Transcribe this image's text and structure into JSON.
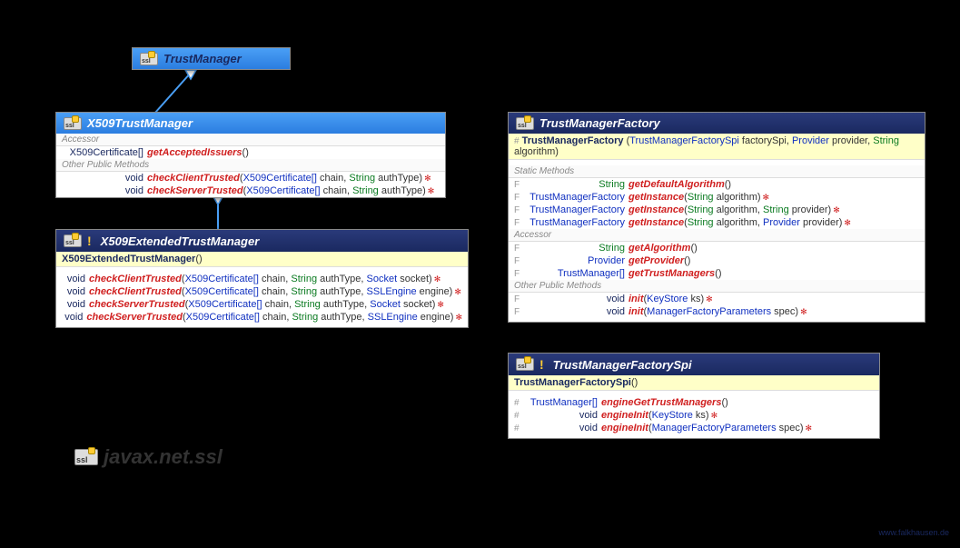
{
  "package": "javax.net.ssl",
  "sslBadge": "ssl",
  "footer": "www.falkhausen.de",
  "trustManager": {
    "title": "TrustManager"
  },
  "x509TrustManager": {
    "title": "X509TrustManager",
    "sec_accessor": "Accessor",
    "sec_other": "Other Public Methods",
    "m1_ret": "X509Certificate[]",
    "m1_name": "getAcceptedIssuers",
    "m1_params": "()",
    "m2_ret": "void",
    "m2_name": "checkClientTrusted",
    "m2_p1": "X509Certificate[]",
    "m2_p1n": " chain, ",
    "m2_p2": "String",
    "m2_p2n": " authType)",
    "m3_ret": "void",
    "m3_name": "checkServerTrusted",
    "m3_p1": "X509Certificate[]",
    "m3_p1n": " chain, ",
    "m3_p2": "String",
    "m3_p2n": " authType)"
  },
  "x509Extended": {
    "title": "X509ExtendedTrustManager",
    "ctor": "X509ExtendedTrustManager",
    "ctor_params": "()",
    "m1_ret": "void",
    "m1_name": "checkClientTrusted",
    "m1_p": "(",
    "m1_p1": "X509Certificate[]",
    "m1_p1n": " chain, ",
    "m1_p2": "String",
    "m1_p2n": " authType, ",
    "m1_p3": "Socket",
    "m1_p3n": " socket)",
    "m2_ret": "void",
    "m2_name": "checkClientTrusted",
    "m2_p": "(",
    "m2_p1": "X509Certificate[]",
    "m2_p1n": " chain, ",
    "m2_p2": "String",
    "m2_p2n": " authType, ",
    "m2_p3": "SSLEngine",
    "m2_p3n": " engine)",
    "m3_ret": "void",
    "m3_name": "checkServerTrusted",
    "m3_p": "(",
    "m3_p1": "X509Certificate[]",
    "m3_p1n": " chain, ",
    "m3_p2": "String",
    "m3_p2n": " authType, ",
    "m3_p3": "Socket",
    "m3_p3n": " socket)",
    "m4_ret": "void",
    "m4_name": "checkServerTrusted",
    "m4_p": "(",
    "m4_p1": "X509Certificate[]",
    "m4_p1n": " chain, ",
    "m4_p2": "String",
    "m4_p2n": " authType, ",
    "m4_p3": "SSLEngine",
    "m4_p3n": " engine)"
  },
  "factory": {
    "title": "TrustManagerFactory",
    "ctor_mod": "#",
    "ctor": "TrustManagerFactory",
    "ctor_p": "(",
    "ctor_p1": "TrustManagerFactorySpi",
    "ctor_p1n": " factorySpi, ",
    "ctor_p2": "Provider",
    "ctor_p2n": " provider, ",
    "ctor_p3": "String",
    "ctor_p3n": " algorithm)",
    "sec_static": "Static Methods",
    "sec_accessor": "Accessor",
    "sec_other": "Other Public Methods",
    "s1_mod": "F",
    "s1_ret": "String",
    "s1_name": "getDefaultAlgorithm",
    "s1_params": "()",
    "s2_mod": "F",
    "s2_ret": "TrustManagerFactory",
    "s2_name": "getInstance",
    "s2_p": "(",
    "s2_p1": "String",
    "s2_p1n": " algorithm)",
    "s3_mod": "F",
    "s3_ret": "TrustManagerFactory",
    "s3_name": "getInstance",
    "s3_p": "(",
    "s3_p1": "String",
    "s3_p1n": " algorithm, ",
    "s3_p2": "String",
    "s3_p2n": " provider)",
    "s4_mod": "F",
    "s4_ret": "TrustManagerFactory",
    "s4_name": "getInstance",
    "s4_p": "(",
    "s4_p1": "String",
    "s4_p1n": " algorithm, ",
    "s4_p2": "Provider",
    "s4_p2n": " provider)",
    "a1_mod": "F",
    "a1_ret": "String",
    "a1_name": "getAlgorithm",
    "a1_params": "()",
    "a2_mod": "F",
    "a2_ret": "Provider",
    "a2_name": "getProvider",
    "a2_params": "()",
    "a3_mod": "F",
    "a3_ret": "TrustManager[]",
    "a3_name": "getTrustManagers",
    "a3_params": "()",
    "o1_mod": "F",
    "o1_ret": "void",
    "o1_name": "init",
    "o1_p": "(",
    "o1_p1": "KeyStore",
    "o1_p1n": " ks)",
    "o2_mod": "F",
    "o2_ret": "void",
    "o2_name": "init",
    "o2_p": "(",
    "o2_p1": "ManagerFactoryParameters",
    "o2_p1n": " spec)"
  },
  "spi": {
    "title": "TrustManagerFactorySpi",
    "ctor": "TrustManagerFactorySpi",
    "ctor_params": "()",
    "m1_mod": "#",
    "m1_ret": "TrustManager[]",
    "m1_name": "engineGetTrustManagers",
    "m1_params": "()",
    "m2_mod": "#",
    "m2_ret": "void",
    "m2_name": "engineInit",
    "m2_p": "(",
    "m2_p1": "KeyStore",
    "m2_p1n": " ks)",
    "m3_mod": "#",
    "m3_ret": "void",
    "m3_name": "engineInit",
    "m3_p": "(",
    "m3_p1": "ManagerFactoryParameters",
    "m3_p1n": " spec)"
  }
}
